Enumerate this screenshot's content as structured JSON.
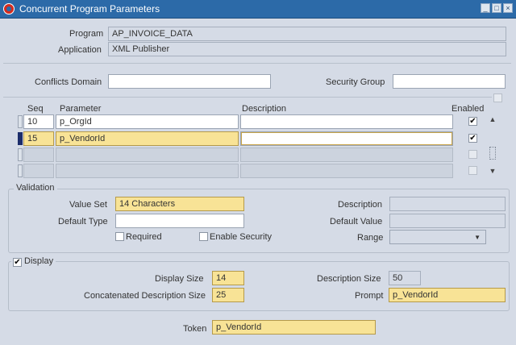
{
  "window": {
    "title": "Concurrent Program Parameters"
  },
  "header": {
    "program_label": "Program",
    "program_value": "AP_INVOICE_DATA",
    "application_label": "Application",
    "application_value": "XML Publisher"
  },
  "conflicts": {
    "domain_label": "Conflicts Domain",
    "domain_value": "",
    "security_label": "Security Group",
    "security_value": ""
  },
  "grid": {
    "headers": {
      "seq": "Seq",
      "parameter": "Parameter",
      "description": "Description",
      "enabled": "Enabled"
    },
    "rows": [
      {
        "seq": "10",
        "parameter": "p_OrgId",
        "description": "",
        "enabled": true
      },
      {
        "seq": "15",
        "parameter": "p_VendorId",
        "description": "",
        "enabled": true
      },
      {
        "seq": "",
        "parameter": "",
        "description": "",
        "enabled": false
      },
      {
        "seq": "",
        "parameter": "",
        "description": "",
        "enabled": false
      }
    ]
  },
  "validation": {
    "legend": "Validation",
    "value_set_label": "Value Set",
    "value_set": "14 Characters",
    "default_type_label": "Default Type",
    "default_type": "",
    "required_label": "Required",
    "enable_security_label": "Enable Security",
    "description_label": "Description",
    "description": "",
    "default_value_label": "Default Value",
    "default_value": "",
    "range_label": "Range",
    "range": ""
  },
  "display": {
    "legend": "Display",
    "checked": true,
    "display_size_label": "Display Size",
    "display_size": "14",
    "concat_size_label": "Concatenated Description Size",
    "concat_size": "25",
    "desc_size_label": "Description Size",
    "desc_size": "50",
    "prompt_label": "Prompt",
    "prompt": "p_VendorId"
  },
  "token": {
    "label": "Token",
    "value": "p_VendorId"
  },
  "colors": {
    "titlebar": "#2c6aa8",
    "required_field": "#f8e396",
    "background": "#d5dbe6"
  }
}
